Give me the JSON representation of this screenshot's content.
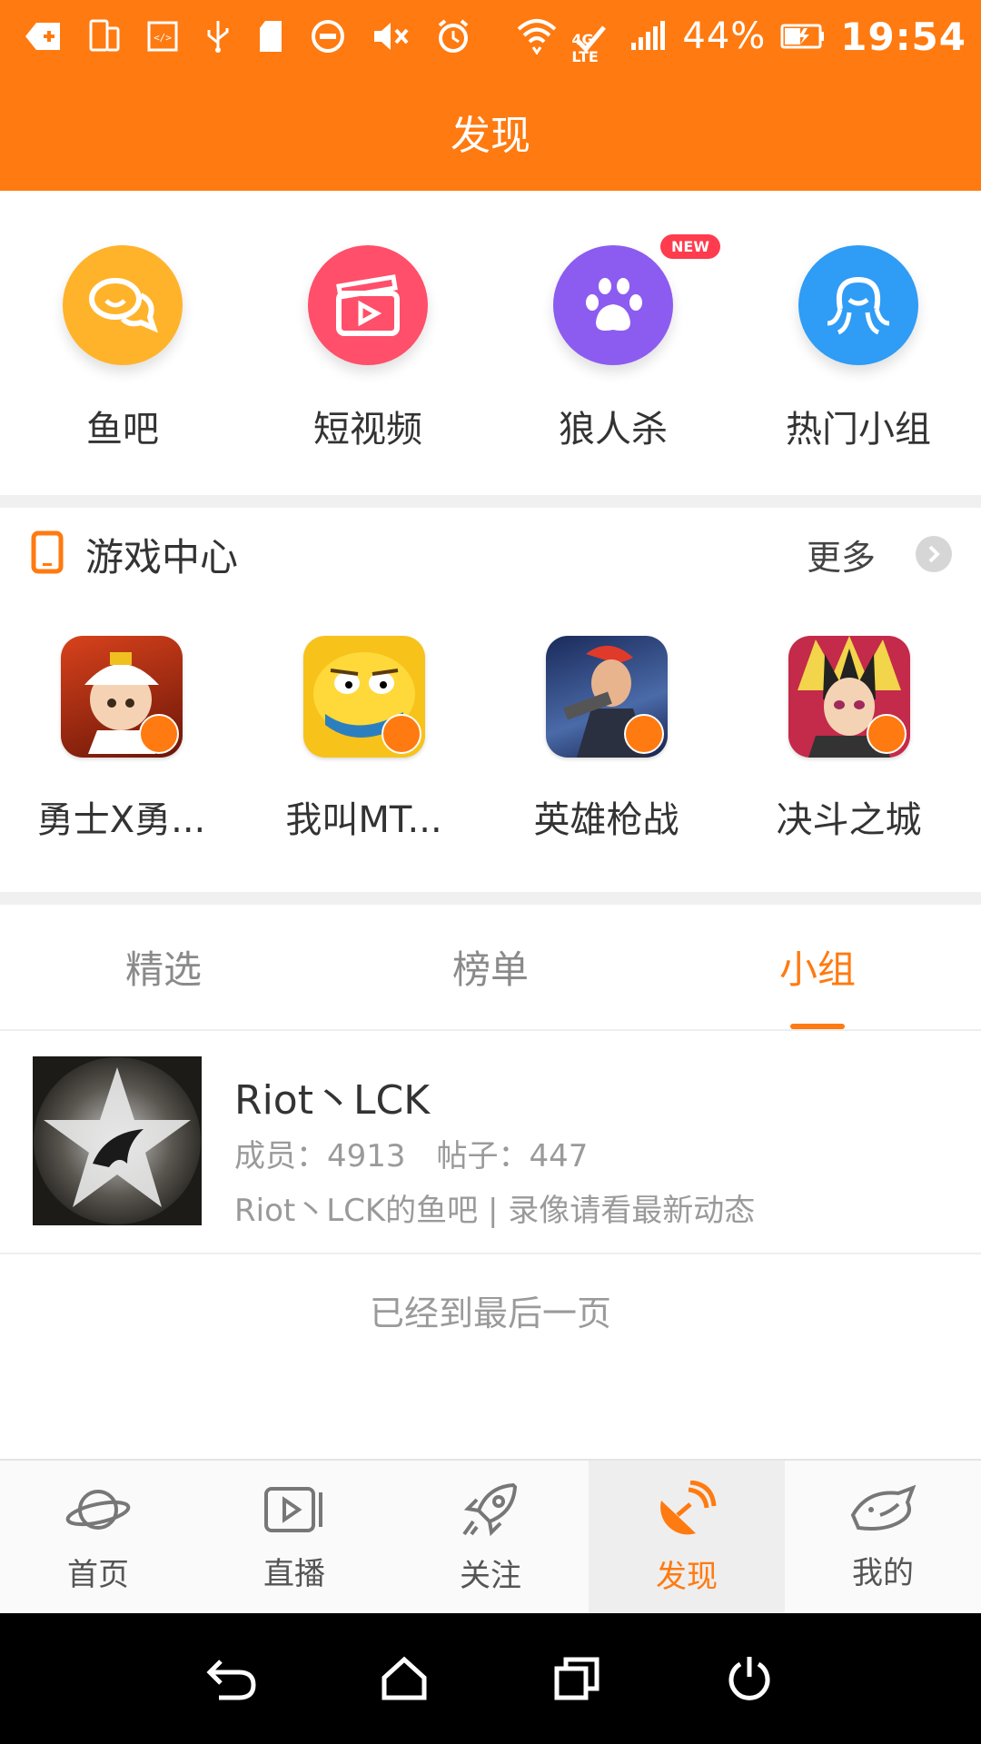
{
  "status_bar": {
    "network": "4G LTE",
    "battery": "44%",
    "time": "19:54"
  },
  "header": {
    "title": "发现"
  },
  "features": [
    {
      "label": "鱼吧",
      "icon": "chat-bubbles-icon",
      "color": "#ffb32a"
    },
    {
      "label": "短视频",
      "icon": "clapperboard-icon",
      "color": "#ff4f6a"
    },
    {
      "label": "狼人杀",
      "icon": "paw-icon",
      "color": "#8c5cf0",
      "badge": "NEW"
    },
    {
      "label": "热门小组",
      "icon": "octopus-icon",
      "color": "#2f9cf6"
    }
  ],
  "game_center": {
    "title": "游戏中心",
    "more": "更多",
    "games": [
      {
        "label": "勇士X勇..."
      },
      {
        "label": "我叫MT..."
      },
      {
        "label": "英雄枪战"
      },
      {
        "label": "决斗之城"
      }
    ]
  },
  "tabs": [
    {
      "label": "精选"
    },
    {
      "label": "榜单"
    },
    {
      "label": "小组",
      "active": true
    }
  ],
  "group": {
    "name": "Riot丶LCK",
    "members": "成员：4913",
    "posts": "帖子：447",
    "description": "Riot丶LCK的鱼吧 | 录像请看最新动态"
  },
  "end_text": "已经到最后一页",
  "bottom_nav": [
    {
      "label": "首页",
      "icon": "planet-icon"
    },
    {
      "label": "直播",
      "icon": "video-play-icon"
    },
    {
      "label": "关注",
      "icon": "rocket-icon"
    },
    {
      "label": "发现",
      "icon": "satellite-dish-icon",
      "active": true
    },
    {
      "label": "我的",
      "icon": "fish-icon"
    }
  ],
  "colors": {
    "accent": "#ff7a10"
  }
}
